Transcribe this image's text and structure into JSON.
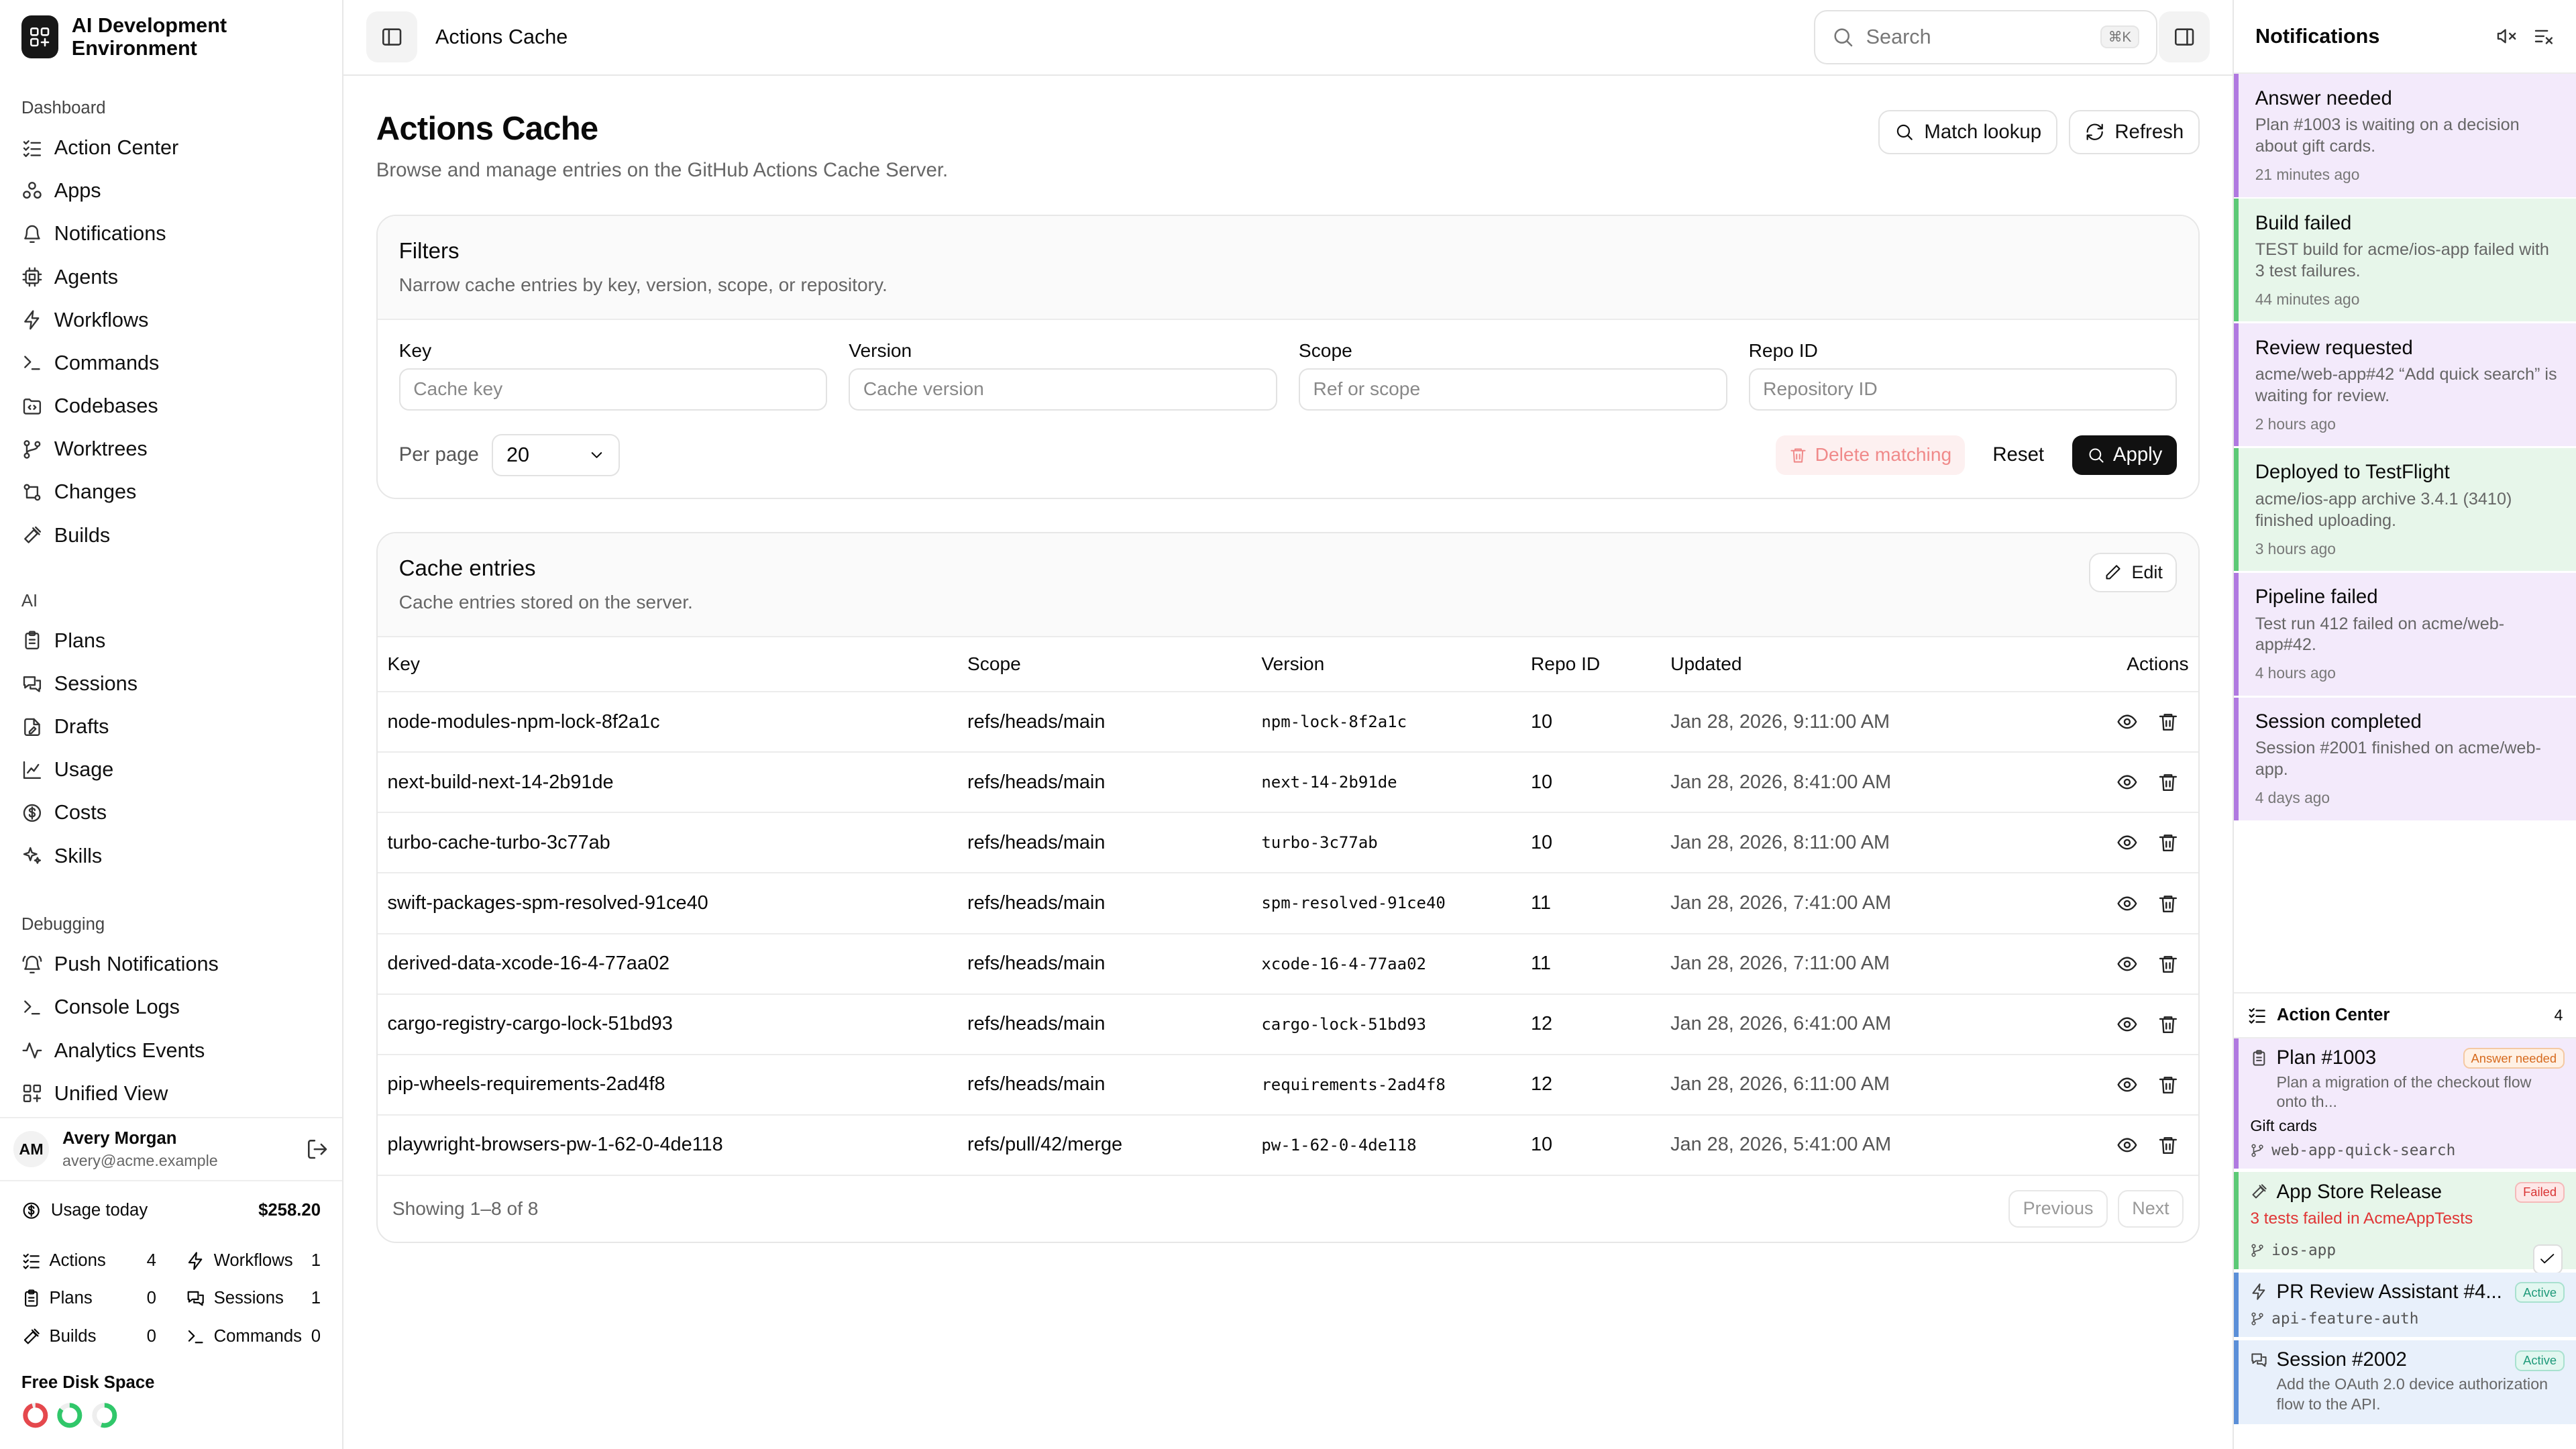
{
  "app": {
    "name": "AI Development Environment"
  },
  "sidebar": {
    "sections": [
      {
        "title": "Dashboard",
        "items": [
          {
            "label": "Action Center",
            "icon": "list-checks-icon"
          },
          {
            "label": "Apps",
            "icon": "apps-icon"
          },
          {
            "label": "Notifications",
            "icon": "bell-icon"
          },
          {
            "label": "Agents",
            "icon": "cpu-icon"
          },
          {
            "label": "Workflows",
            "icon": "workflow-icon"
          },
          {
            "label": "Commands",
            "icon": "terminal-icon"
          },
          {
            "label": "Codebases",
            "icon": "folder-code-icon"
          },
          {
            "label": "Worktrees",
            "icon": "git-branch-icon"
          },
          {
            "label": "Changes",
            "icon": "git-compare-icon"
          },
          {
            "label": "Builds",
            "icon": "hammer-icon"
          }
        ]
      },
      {
        "title": "AI",
        "items": [
          {
            "label": "Plans",
            "icon": "clipboard-icon"
          },
          {
            "label": "Sessions",
            "icon": "messages-icon"
          },
          {
            "label": "Drafts",
            "icon": "file-pen-icon"
          },
          {
            "label": "Usage",
            "icon": "chart-icon"
          },
          {
            "label": "Costs",
            "icon": "dollar-icon"
          },
          {
            "label": "Skills",
            "icon": "sparkles-icon"
          }
        ]
      },
      {
        "title": "Debugging",
        "items": [
          {
            "label": "Push Notifications",
            "icon": "bell-ring-icon"
          },
          {
            "label": "Console Logs",
            "icon": "terminal-icon"
          },
          {
            "label": "Analytics Events",
            "icon": "activity-icon"
          },
          {
            "label": "Unified View",
            "icon": "layout-icon"
          }
        ]
      }
    ],
    "user": {
      "initials": "AM",
      "name": "Avery Morgan",
      "email": "avery@acme.example"
    },
    "usage": {
      "label": "Usage today",
      "amount": "$258.20"
    },
    "stats": [
      {
        "label": "Actions",
        "value": "4",
        "icon": "list-checks-icon"
      },
      {
        "label": "Workflows",
        "value": "1",
        "icon": "workflow-icon"
      },
      {
        "label": "Plans",
        "value": "0",
        "icon": "clipboard-icon"
      },
      {
        "label": "Sessions",
        "value": "1",
        "icon": "messages-icon"
      },
      {
        "label": "Builds",
        "value": "0",
        "icon": "hammer-icon"
      },
      {
        "label": "Commands",
        "value": "0",
        "icon": "terminal-icon"
      }
    ],
    "disk": {
      "label": "Free Disk Space",
      "rings": [
        {
          "color": "#e5484d",
          "fraction": 0.95
        },
        {
          "color": "#30c76a",
          "fraction": 0.85
        },
        {
          "color": "#30c76a",
          "fraction": 0.55
        }
      ]
    }
  },
  "topbar": {
    "breadcrumb": "Actions Cache",
    "search_placeholder": "Search",
    "search_shortcut": "⌘K"
  },
  "page": {
    "title": "Actions Cache",
    "subtitle": "Browse and manage entries on the GitHub Actions Cache Server.",
    "match_lookup_label": "Match lookup",
    "refresh_label": "Refresh"
  },
  "filters": {
    "title": "Filters",
    "description": "Narrow cache entries by key, version, scope, or repository.",
    "fields": [
      {
        "label": "Key",
        "placeholder": "Cache key"
      },
      {
        "label": "Version",
        "placeholder": "Cache version"
      },
      {
        "label": "Scope",
        "placeholder": "Ref or scope"
      },
      {
        "label": "Repo ID",
        "placeholder": "Repository ID"
      }
    ],
    "per_page_label": "Per page",
    "per_page_value": "20",
    "delete_label": "Delete matching",
    "reset_label": "Reset",
    "apply_label": "Apply"
  },
  "entries": {
    "title": "Cache entries",
    "description": "Cache entries stored on the server.",
    "edit_label": "Edit",
    "columns": [
      "Key",
      "Scope",
      "Version",
      "Repo ID",
      "Updated",
      "Actions"
    ],
    "rows": [
      {
        "key": "node-modules-npm-lock-8f2a1c",
        "scope": "refs/heads/main",
        "version": "npm-lock-8f2a1c",
        "repo": "10",
        "updated": "Jan 28, 2026, 9:11:00 AM"
      },
      {
        "key": "next-build-next-14-2b91de",
        "scope": "refs/heads/main",
        "version": "next-14-2b91de",
        "repo": "10",
        "updated": "Jan 28, 2026, 8:41:00 AM"
      },
      {
        "key": "turbo-cache-turbo-3c77ab",
        "scope": "refs/heads/main",
        "version": "turbo-3c77ab",
        "repo": "10",
        "updated": "Jan 28, 2026, 8:11:00 AM"
      },
      {
        "key": "swift-packages-spm-resolved-91ce40",
        "scope": "refs/heads/main",
        "version": "spm-resolved-91ce40",
        "repo": "11",
        "updated": "Jan 28, 2026, 7:41:00 AM"
      },
      {
        "key": "derived-data-xcode-16-4-77aa02",
        "scope": "refs/heads/main",
        "version": "xcode-16-4-77aa02",
        "repo": "11",
        "updated": "Jan 28, 2026, 7:11:00 AM"
      },
      {
        "key": "cargo-registry-cargo-lock-51bd93",
        "scope": "refs/heads/main",
        "version": "cargo-lock-51bd93",
        "repo": "12",
        "updated": "Jan 28, 2026, 6:41:00 AM"
      },
      {
        "key": "pip-wheels-requirements-2ad4f8",
        "scope": "refs/heads/main",
        "version": "requirements-2ad4f8",
        "repo": "12",
        "updated": "Jan 28, 2026, 6:11:00 AM"
      },
      {
        "key": "playwright-browsers-pw-1-62-0-4de118",
        "scope": "refs/pull/42/merge",
        "version": "pw-1-62-0-4de118",
        "repo": "10",
        "updated": "Jan 28, 2026, 5:41:00 AM"
      }
    ],
    "footer": "Showing 1–8 of 8",
    "prev_label": "Previous",
    "next_label": "Next"
  },
  "notifications": {
    "title": "Notifications",
    "items": [
      {
        "title": "Answer needed",
        "body": "Plan #1003 is waiting on a decision about gift cards.",
        "time": "21 minutes ago",
        "color": "purple"
      },
      {
        "title": "Build failed",
        "body": "TEST build for acme/ios-app failed with 3 test failures.",
        "time": "44 minutes ago",
        "color": "green"
      },
      {
        "title": "Review requested",
        "body": "acme/web-app#42 “Add quick search” is waiting for review.",
        "time": "2 hours ago",
        "color": "purple"
      },
      {
        "title": "Deployed to TestFlight",
        "body": "acme/ios-app archive 3.4.1 (3410) finished uploading.",
        "time": "3 hours ago",
        "color": "green"
      },
      {
        "title": "Pipeline failed",
        "body": "Test run 412 failed on acme/web-app#42.",
        "time": "4 hours ago",
        "color": "purple"
      },
      {
        "title": "Session completed",
        "body": "Session #2001 finished on acme/web-app.",
        "time": "4 days ago",
        "color": "purple"
      }
    ]
  },
  "action_center": {
    "title": "Action Center",
    "count": "4",
    "items": [
      {
        "title": "Plan #1003",
        "badge": "Answer needed",
        "desc": "Plan a migration of the checkout flow onto th...",
        "label": "Gift cards",
        "branch": "web-app-quick-search"
      },
      {
        "title": "App Store Release",
        "badge": "Failed",
        "error": "3 tests failed in AcmeAppTests",
        "branch": "ios-app"
      },
      {
        "title": "PR Review Assistant #4...",
        "badge": "Active",
        "branch": "api-feature-auth"
      },
      {
        "title": "Session #2002",
        "badge": "Active",
        "desc": "Add the OAuth 2.0 device authorization flow to the API."
      }
    ]
  }
}
